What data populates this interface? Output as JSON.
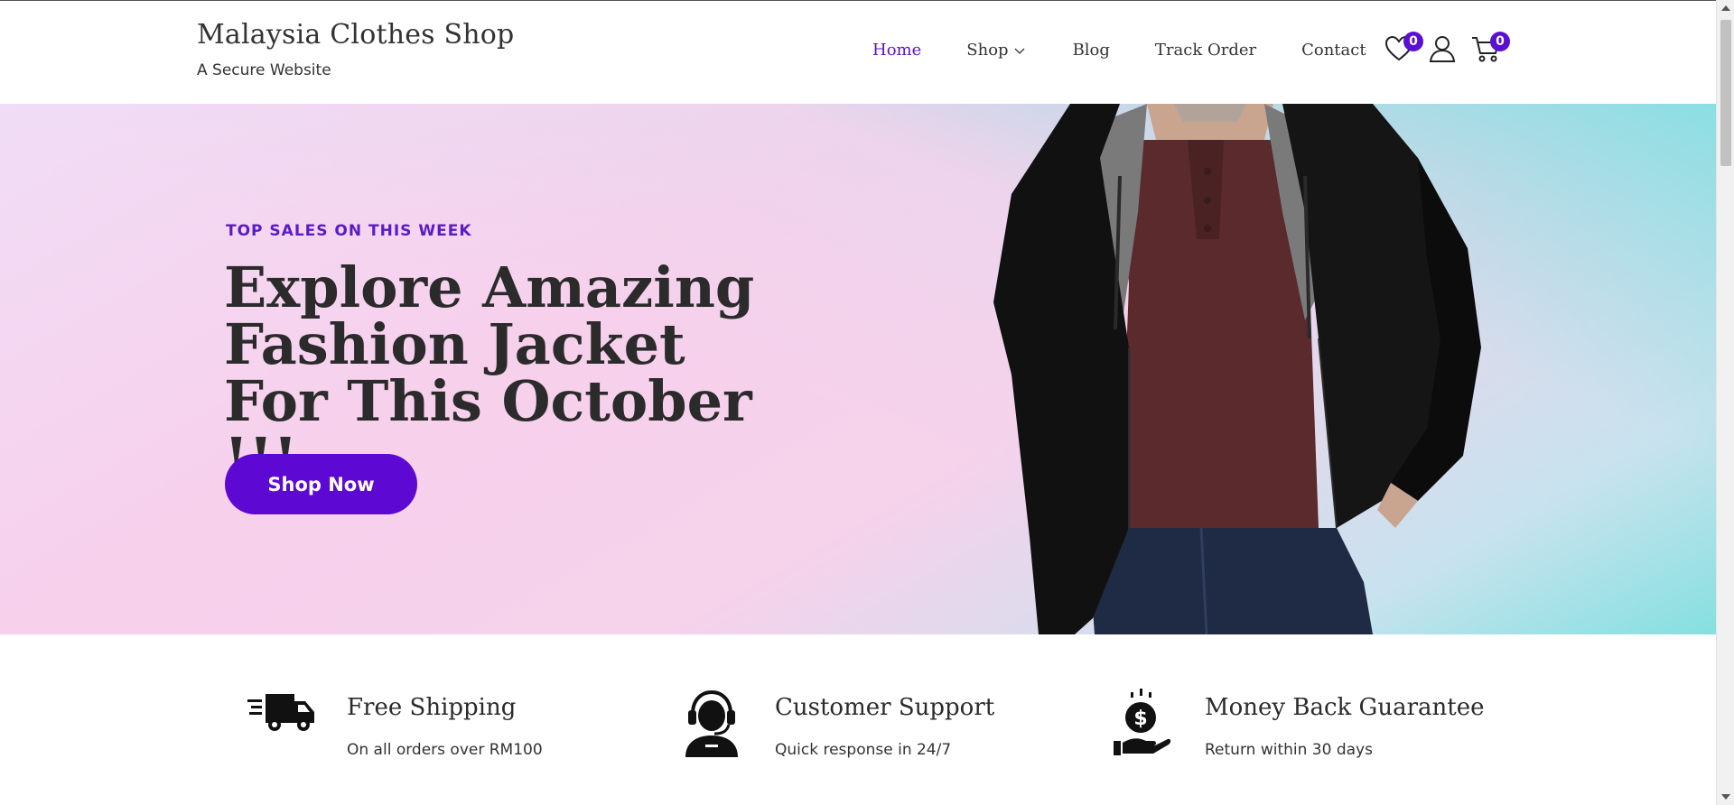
{
  "header": {
    "site_title": "Malaysia Clothes Shop",
    "tagline": "A Secure Website",
    "nav": [
      {
        "label": "Home",
        "active": true
      },
      {
        "label": "Shop",
        "has_dropdown": true
      },
      {
        "label": "Blog"
      },
      {
        "label": "Track Order"
      },
      {
        "label": "Contact"
      }
    ],
    "icons": {
      "wishlist": {
        "icon": "heart-icon",
        "count": "0"
      },
      "account": {
        "icon": "user-icon"
      },
      "cart": {
        "icon": "cart-icon",
        "count": "0"
      }
    }
  },
  "hero": {
    "eyebrow": "TOP SALES ON THIS WEEK",
    "title": "Explore Amazing Fashion Jacket For This October !!!",
    "cta_label": "Shop Now",
    "image": "man-in-black-hooded-jacket"
  },
  "features": [
    {
      "icon": "delivery-truck-icon",
      "title": "Free Shipping",
      "subtitle": "On all orders over RM100"
    },
    {
      "icon": "customer-support-icon",
      "title": "Customer Support",
      "subtitle": "Quick response in 24/7"
    },
    {
      "icon": "money-back-icon",
      "title": "Money Back Guarantee",
      "subtitle": "Return within 30 days"
    }
  ],
  "colors": {
    "accent": "#5d08d3",
    "nav_active": "#5a12c9",
    "eyebrow": "#5b1bc6",
    "text": "#2b2b2b"
  }
}
